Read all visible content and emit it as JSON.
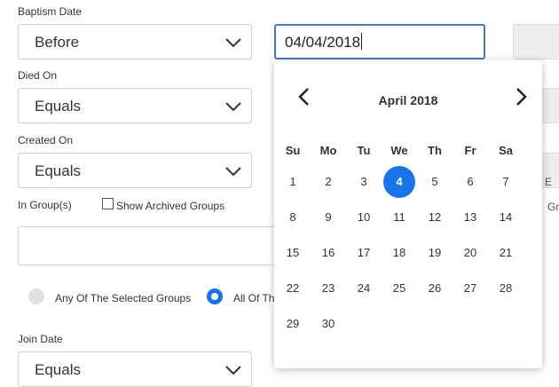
{
  "fields": {
    "baptism_label": "Baptism Date",
    "baptism_op": "Before",
    "baptism_date": "04/04/2018",
    "died_label": "Died On",
    "died_op": "Equals",
    "created_label": "Created On",
    "created_op": "Equals",
    "in_group_label": "In Group(s)",
    "show_archived_label": "Show Archived Groups",
    "show_archived_checked": false,
    "radio_any_label": "Any Of The Selected Groups",
    "radio_all_label": "All Of Th",
    "join_label": "Join Date",
    "join_op": "Equals"
  },
  "calendar": {
    "month_label": "April 2018",
    "weekdays": [
      "Su",
      "Mo",
      "Tu",
      "We",
      "Th",
      "Fr",
      "Sa"
    ],
    "weeks": [
      [
        "1",
        "2",
        "3",
        "4",
        "5",
        "6",
        "7"
      ],
      [
        "8",
        "9",
        "10",
        "11",
        "12",
        "13",
        "14"
      ],
      [
        "15",
        "16",
        "17",
        "18",
        "19",
        "20",
        "21"
      ],
      [
        "22",
        "23",
        "24",
        "25",
        "26",
        "27",
        "28"
      ],
      [
        "29",
        "30",
        "",
        "",
        "",
        "",
        ""
      ]
    ],
    "selected_day": "4",
    "selected_color": "#1a73e8"
  },
  "edge": {
    "partial_text_1": "E",
    "partial_text_2": "Gr"
  }
}
